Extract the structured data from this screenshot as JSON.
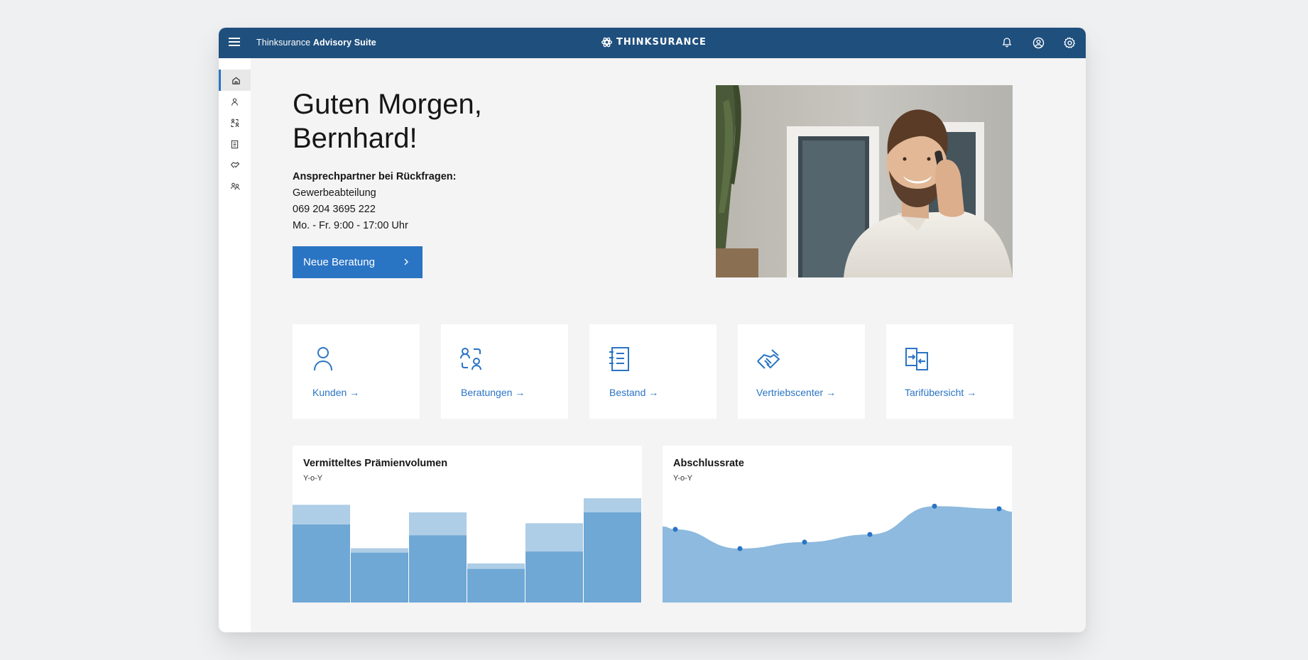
{
  "header": {
    "app_name_prefix": "Thinksurance",
    "app_name_suffix": "Advisory Suite",
    "brand": "THINKSURANCE",
    "icons": [
      "bell-icon",
      "user-circle-icon",
      "settings-icon"
    ]
  },
  "sidebar": {
    "items": [
      {
        "icon": "home-icon",
        "active": true
      },
      {
        "icon": "user-icon",
        "active": false
      },
      {
        "icon": "consultation-icon",
        "active": false
      },
      {
        "icon": "portfolio-icon",
        "active": false
      },
      {
        "icon": "handshake-icon",
        "active": false
      },
      {
        "icon": "users-icon",
        "active": false
      }
    ]
  },
  "main": {
    "greeting_line1": "Guten Morgen,",
    "greeting_line2": "Bernhard!",
    "contact": {
      "label": "Ansprechpartner bei Rückfragen:",
      "department": "Gewerbeabteilung",
      "phone": "069 204 3695 222",
      "hours": "Mo. - Fr. 9:00 - 17:00 Uhr"
    },
    "cta_label": "Neue Beratung",
    "tiles": [
      {
        "label": "Kunden",
        "icon": "user-icon"
      },
      {
        "label": "Beratungen",
        "icon": "consultation-icon"
      },
      {
        "label": "Bestand",
        "icon": "portfolio-icon"
      },
      {
        "label": "Vertriebscenter",
        "icon": "handshake-icon"
      },
      {
        "label": "Tarifübersicht",
        "icon": "tariff-compare-icon"
      }
    ],
    "arrow": "→"
  },
  "colors": {
    "brand_navy": "#1f4f7d",
    "accent_blue": "#2a74c4",
    "bar_dark": "#6fa7d5",
    "bar_light": "#aecde6",
    "area_fill": "#8dbade",
    "point": "#2a74c4"
  },
  "chart_data": [
    {
      "type": "bar",
      "title": "Vermitteltes Prämienvolumen",
      "subtitle": "Y-o-Y",
      "stacked": true,
      "series": [
        {
          "values": [
            72,
            46,
            62,
            31,
            47,
            83
          ]
        },
        {
          "values": [
            18,
            4,
            21,
            5,
            26,
            13
          ]
        }
      ],
      "ylim": [
        0,
        100
      ],
      "grid": false
    },
    {
      "type": "area",
      "title": "Abschlussrate",
      "subtitle": "Y-o-Y",
      "values": [
        57,
        42,
        47,
        53,
        75,
        73
      ],
      "ylim": [
        0,
        100
      ],
      "grid": false
    }
  ]
}
